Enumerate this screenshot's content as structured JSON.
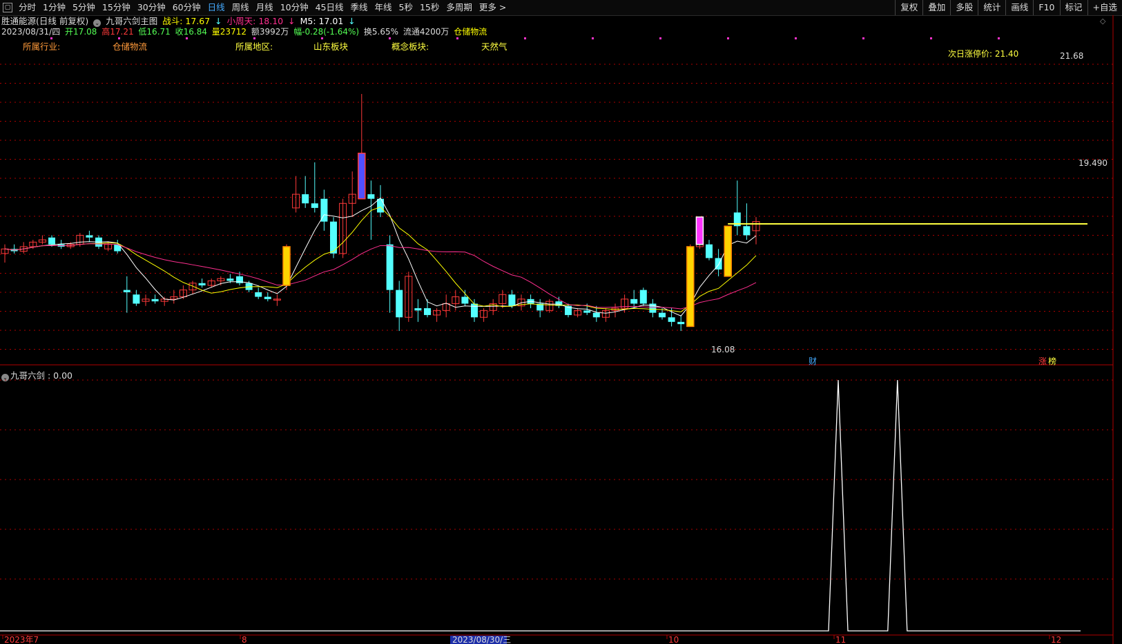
{
  "toolbar": {
    "items": [
      "分时",
      "1分钟",
      "5分钟",
      "15分钟",
      "30分钟",
      "60分钟",
      "日线",
      "周线",
      "月线",
      "10分钟",
      "45日线",
      "季线",
      "年线",
      "5秒",
      "15秒",
      "多周期",
      "更多 >"
    ],
    "active_index": 6,
    "right_items": [
      "复权",
      "叠加",
      "多股",
      "统计",
      "画线",
      "F10",
      "标记",
      "+自选"
    ]
  },
  "header": {
    "stock_name": "胜通能源(日线 前复权)",
    "indicator_name": "九哥六剑主图",
    "zhandou_label": "战斗: 17.67",
    "xiaozhoutian_label": "小周天: 18.10",
    "m5_label": "M5: 17.01",
    "date": "2023/08/31/四",
    "open": "开17.08",
    "high": "高17.21",
    "low": "低16.71",
    "close": "收16.84",
    "volume": "量23712",
    "amount": "额3992万",
    "change": "幅-0.28(-1.64%)",
    "turnover": "换5.65%",
    "float": "流通4200万",
    "sector": "仓储物流"
  },
  "indicator_row": {
    "industry_label": "所属行业:",
    "industry_value": "仓储物流",
    "region_label": "所属地区:",
    "region_value": "山东板块",
    "concept_label": "概念板块:",
    "concept_value": "天然气"
  },
  "annotations": {
    "limit_price": "次日涨停价:  21.40",
    "high_mark": "21.68",
    "low_mark": "16.08",
    "current_mark": "19.490",
    "cai_badge": "财",
    "zhang_badge": "涨",
    "zhang_badge2": "榜"
  },
  "panel2": {
    "title": "九哥六剑 : 0.00",
    "spikes_at_candle": [
      45,
      48
    ]
  },
  "xaxis": {
    "labels": [
      "2023年7",
      "8",
      "2023/08/30/三",
      "10",
      "11",
      "12"
    ]
  },
  "colors": {
    "up": "#ff3a3a",
    "down": "#54ffff",
    "ma5": "#ffffff",
    "ma10": "#ffff00",
    "ma20": "#ff2f8f",
    "axis_red": "#b00000"
  },
  "chart_data": {
    "type": "candlestick",
    "y_range": [
      15.5,
      22.2
    ],
    "candles": [
      [
        17.7,
        17.9,
        17.5,
        17.8
      ],
      [
        17.8,
        17.9,
        17.7,
        17.75
      ],
      [
        17.75,
        17.95,
        17.7,
        17.85
      ],
      [
        17.85,
        18.0,
        17.8,
        17.95
      ],
      [
        17.95,
        18.1,
        17.9,
        18.0
      ],
      [
        18.05,
        18.1,
        17.85,
        17.9
      ],
      [
        17.9,
        18.0,
        17.8,
        17.85
      ],
      [
        17.85,
        17.95,
        17.8,
        17.9
      ],
      [
        17.9,
        18.15,
        17.85,
        18.1
      ],
      [
        18.1,
        18.2,
        17.95,
        18.05
      ],
      [
        18.05,
        18.1,
        17.8,
        17.85
      ],
      [
        17.8,
        17.95,
        17.75,
        17.9
      ],
      [
        17.9,
        18.0,
        17.7,
        17.75
      ],
      [
        16.9,
        17.2,
        16.4,
        16.85
      ],
      [
        16.8,
        16.9,
        16.55,
        16.6
      ],
      [
        16.65,
        16.8,
        16.55,
        16.7
      ],
      [
        16.7,
        16.8,
        16.6,
        16.65
      ],
      [
        16.65,
        16.75,
        16.55,
        16.7
      ],
      [
        16.7,
        16.9,
        16.6,
        16.75
      ],
      [
        16.75,
        17.0,
        16.7,
        16.9
      ],
      [
        16.9,
        17.1,
        16.8,
        17.05
      ],
      [
        17.05,
        17.15,
        16.95,
        17.0
      ],
      [
        17.0,
        17.15,
        16.95,
        17.1
      ],
      [
        17.1,
        17.2,
        17.0,
        17.15
      ],
      [
        17.15,
        17.25,
        17.05,
        17.1
      ],
      [
        17.2,
        17.3,
        17.0,
        17.05
      ],
      [
        17.05,
        17.1,
        16.85,
        16.9
      ],
      [
        16.85,
        16.95,
        16.7,
        16.75
      ],
      [
        16.75,
        16.85,
        16.65,
        16.7
      ],
      [
        16.7,
        16.8,
        16.55,
        16.7
      ],
      [
        17.0,
        17.9,
        16.9,
        17.85
      ],
      [
        18.7,
        19.4,
        18.6,
        19.0
      ],
      [
        19.0,
        19.4,
        18.7,
        18.8
      ],
      [
        18.8,
        19.7,
        18.6,
        18.7
      ],
      [
        18.9,
        19.1,
        18.2,
        18.4
      ],
      [
        18.4,
        18.5,
        17.6,
        17.7
      ],
      [
        17.7,
        18.9,
        17.6,
        18.8
      ],
      [
        18.8,
        19.5,
        18.5,
        19.0
      ],
      [
        19.0,
        21.2,
        18.9,
        19.3
      ],
      [
        19.0,
        19.3,
        18.0,
        18.9
      ],
      [
        18.9,
        19.2,
        18.5,
        18.6
      ],
      [
        17.9,
        18.1,
        16.4,
        16.9
      ],
      [
        16.9,
        17.1,
        16.0,
        16.3
      ],
      [
        16.3,
        17.3,
        16.2,
        17.2
      ],
      [
        16.5,
        16.7,
        16.2,
        16.45
      ],
      [
        16.5,
        16.7,
        16.3,
        16.35
      ],
      [
        16.35,
        16.5,
        16.2,
        16.45
      ],
      [
        16.45,
        16.8,
        16.3,
        16.6
      ],
      [
        16.6,
        16.9,
        16.45,
        16.75
      ],
      [
        16.75,
        16.9,
        16.55,
        16.6
      ],
      [
        16.6,
        16.7,
        16.2,
        16.3
      ],
      [
        16.3,
        16.5,
        16.2,
        16.45
      ],
      [
        16.45,
        16.7,
        16.35,
        16.6
      ],
      [
        16.6,
        16.9,
        16.5,
        16.8
      ],
      [
        16.8,
        16.9,
        16.5,
        16.55
      ],
      [
        16.55,
        16.8,
        16.45,
        16.7
      ],
      [
        16.7,
        16.8,
        16.5,
        16.6
      ],
      [
        16.6,
        16.7,
        16.3,
        16.45
      ],
      [
        16.45,
        16.7,
        16.4,
        16.65
      ],
      [
        16.65,
        16.75,
        16.5,
        16.55
      ],
      [
        16.55,
        16.6,
        16.3,
        16.35
      ],
      [
        16.35,
        16.5,
        16.3,
        16.45
      ],
      [
        16.45,
        16.6,
        16.35,
        16.4
      ],
      [
        16.4,
        16.55,
        16.2,
        16.3
      ],
      [
        16.3,
        16.5,
        16.2,
        16.45
      ],
      [
        16.45,
        16.6,
        16.3,
        16.5
      ],
      [
        16.5,
        16.8,
        16.4,
        16.7
      ],
      [
        16.7,
        16.9,
        16.5,
        16.6
      ],
      [
        16.9,
        16.95,
        16.55,
        16.6
      ],
      [
        16.6,
        16.7,
        16.3,
        16.4
      ],
      [
        16.4,
        16.5,
        16.25,
        16.3
      ],
      [
        16.3,
        16.5,
        16.1,
        16.2
      ],
      [
        16.2,
        16.35,
        16.0,
        16.15
      ],
      [
        16.15,
        17.9,
        16.1,
        17.85
      ],
      [
        17.85,
        18.4,
        17.8,
        18.3
      ],
      [
        17.9,
        18.0,
        17.55,
        17.6
      ],
      [
        17.6,
        17.8,
        17.2,
        17.35
      ],
      [
        17.35,
        18.3,
        17.2,
        18.3
      ],
      [
        18.6,
        19.3,
        18.1,
        18.3
      ],
      [
        18.3,
        18.8,
        18.0,
        18.1
      ],
      [
        18.2,
        18.5,
        17.9,
        18.4
      ]
    ]
  }
}
